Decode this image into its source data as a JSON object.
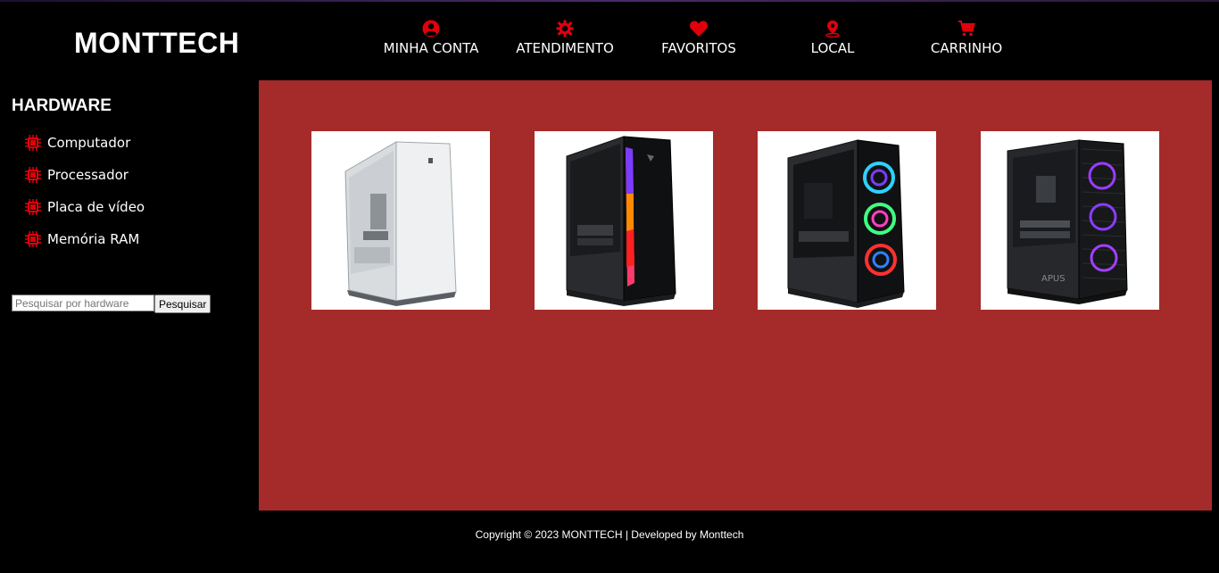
{
  "header": {
    "logo": "MONTTECH",
    "nav": [
      {
        "label": "MINHA CONTA",
        "icon": "user-circle-icon"
      },
      {
        "label": "ATENDIMENTO",
        "icon": "support-gear-icon"
      },
      {
        "label": "FAVORITOS",
        "icon": "heart-icon"
      },
      {
        "label": "LOCAL",
        "icon": "location-pin-icon"
      },
      {
        "label": "CARRINHO",
        "icon": "cart-icon"
      }
    ]
  },
  "sidebar": {
    "title": "HARDWARE",
    "items": [
      {
        "label": "Computador",
        "icon": "chip-icon"
      },
      {
        "label": "Processador",
        "icon": "chip-icon"
      },
      {
        "label": "Placa de vídeo",
        "icon": "chip-icon"
      },
      {
        "label": "Memória RAM",
        "icon": "chip-icon"
      }
    ],
    "search": {
      "placeholder": "Pesquisar por hardware",
      "button_label": "Pesquisar"
    }
  },
  "main": {
    "products": [
      {
        "name": "white-pc-case"
      },
      {
        "name": "black-rgb-strip-pc-case"
      },
      {
        "name": "black-rgb-fans-pc-case"
      },
      {
        "name": "black-mesh-rgb-pc-case"
      }
    ]
  },
  "footer": {
    "text": "Copyright © 2023 MONTTECH | Developed by Monttech"
  },
  "colors": {
    "accent": "#e0000b",
    "panel": "#a52a2a",
    "background": "#000000"
  }
}
